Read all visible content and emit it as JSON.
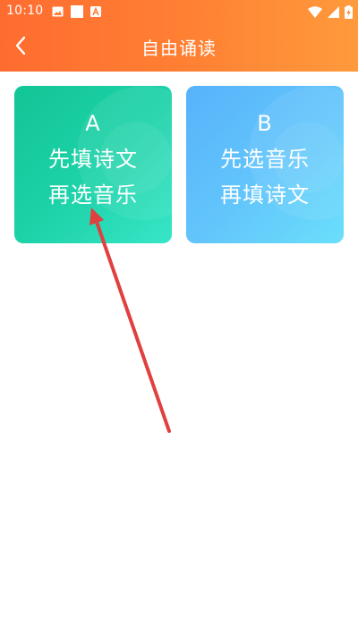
{
  "status_bar": {
    "time": "10:10",
    "icons": [
      "image-icon",
      "square-icon",
      "a-badge-icon",
      "wifi-icon",
      "signal-icon",
      "battery-charging-icon"
    ]
  },
  "header": {
    "title": "自由诵读",
    "back_icon": "chevron-left-icon",
    "gradient_colors": [
      "#ff6c30",
      "#ff9a3c"
    ]
  },
  "options": [
    {
      "letter": "A",
      "line1": "先填诗文",
      "line2": "再选音乐",
      "colors": [
        "#11c596",
        "#37e6c8"
      ]
    },
    {
      "letter": "B",
      "line1": "先选音乐",
      "line2": "再填诗文",
      "colors": [
        "#57b2fb",
        "#6adffb"
      ]
    }
  ],
  "annotation": {
    "type": "arrow",
    "color": "#e0403f",
    "points_to": "option-a-card"
  }
}
